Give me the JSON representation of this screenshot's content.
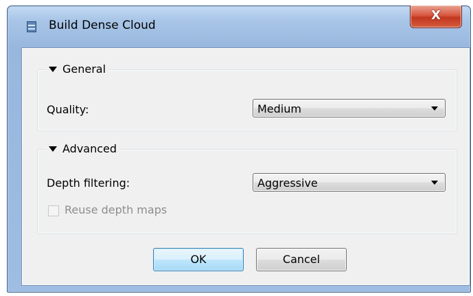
{
  "window": {
    "title": "Build Dense Cloud",
    "close_label": "X"
  },
  "general": {
    "header": "General",
    "quality_label": "Quality:",
    "quality_value": "Medium"
  },
  "advanced": {
    "header": "Advanced",
    "depth_label": "Depth filtering:",
    "depth_value": "Aggressive",
    "reuse_label": "Reuse depth maps",
    "reuse_checked": false,
    "reuse_enabled": false
  },
  "buttons": {
    "ok": "OK",
    "cancel": "Cancel"
  }
}
